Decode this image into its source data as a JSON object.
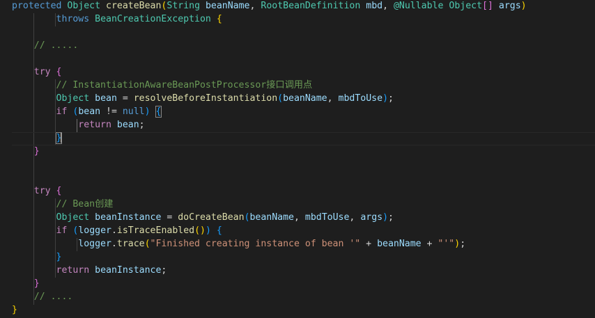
{
  "colors": {
    "background": "#1e1e1e",
    "keyword": "#569cd6",
    "control": "#c586c0",
    "type": "#4ec9b0",
    "function": "#dcdcaa",
    "variable": "#9cdcfe",
    "comment": "#6a9955",
    "string": "#ce9178",
    "bracket_1": "#ffd700",
    "bracket_2": "#da70d6",
    "bracket_3": "#179fff"
  },
  "code": {
    "lines": [
      [
        [
          "kw",
          "protected"
        ],
        [
          "pun",
          " "
        ],
        [
          "type",
          "Object"
        ],
        [
          "pun",
          " "
        ],
        [
          "fn",
          "createBean"
        ],
        [
          "b1",
          "("
        ],
        [
          "type",
          "String"
        ],
        [
          "pun",
          " "
        ],
        [
          "var",
          "beanName"
        ],
        [
          "pun",
          ", "
        ],
        [
          "type",
          "RootBeanDefinition"
        ],
        [
          "pun",
          " "
        ],
        [
          "var",
          "mbd"
        ],
        [
          "pun",
          ", "
        ],
        [
          "type",
          "@Nullable"
        ],
        [
          "pun",
          " "
        ],
        [
          "type",
          "Object"
        ],
        [
          "b2",
          "[]"
        ],
        [
          "pun",
          " "
        ],
        [
          "var",
          "args"
        ],
        [
          "b1",
          ")"
        ]
      ],
      [
        [
          "pun",
          "        "
        ],
        [
          "kw",
          "throws"
        ],
        [
          "pun",
          " "
        ],
        [
          "type",
          "BeanCreationException"
        ],
        [
          "pun",
          " "
        ],
        [
          "b1",
          "{"
        ]
      ],
      [],
      [
        [
          "pun",
          "    "
        ],
        [
          "cmt",
          "// ....."
        ]
      ],
      [],
      [
        [
          "pun",
          "    "
        ],
        [
          "ctl",
          "try"
        ],
        [
          "pun",
          " "
        ],
        [
          "b2",
          "{"
        ]
      ],
      [
        [
          "pun",
          "        "
        ],
        [
          "cmt",
          "// InstantiationAwareBeanPostProcessor接口调用点"
        ]
      ],
      [
        [
          "pun",
          "        "
        ],
        [
          "type",
          "Object"
        ],
        [
          "pun",
          " "
        ],
        [
          "var",
          "bean"
        ],
        [
          "pun",
          " = "
        ],
        [
          "fn",
          "resolveBeforeInstantiation"
        ],
        [
          "b3",
          "("
        ],
        [
          "var",
          "beanName"
        ],
        [
          "pun",
          ", "
        ],
        [
          "var",
          "mbdToUse"
        ],
        [
          "b3",
          ")"
        ],
        [
          "pun",
          ";"
        ]
      ],
      [
        [
          "pun",
          "        "
        ],
        [
          "ctl",
          "if"
        ],
        [
          "pun",
          " "
        ],
        [
          "b3",
          "("
        ],
        [
          "var",
          "bean"
        ],
        [
          "pun",
          " != "
        ],
        [
          "kw",
          "null"
        ],
        [
          "b3",
          ")"
        ],
        [
          "pun",
          " "
        ],
        [
          "b3m",
          "{"
        ]
      ],
      [
        [
          "pun",
          "            "
        ],
        [
          "ctl",
          "return"
        ],
        [
          "pun",
          " "
        ],
        [
          "var",
          "bean"
        ],
        [
          "pun",
          ";"
        ]
      ],
      [
        [
          "pun",
          "        "
        ],
        [
          "b3m",
          "}"
        ],
        [
          "cursor",
          ""
        ]
      ],
      [
        [
          "pun",
          "    "
        ],
        [
          "b2",
          "}"
        ]
      ],
      [],
      [],
      [
        [
          "pun",
          "    "
        ],
        [
          "ctl",
          "try"
        ],
        [
          "pun",
          " "
        ],
        [
          "b2",
          "{"
        ]
      ],
      [
        [
          "pun",
          "        "
        ],
        [
          "cmt",
          "// Bean创建"
        ]
      ],
      [
        [
          "pun",
          "        "
        ],
        [
          "type",
          "Object"
        ],
        [
          "pun",
          " "
        ],
        [
          "var",
          "beanInstance"
        ],
        [
          "pun",
          " = "
        ],
        [
          "fn",
          "doCreateBean"
        ],
        [
          "b3",
          "("
        ],
        [
          "var",
          "beanName"
        ],
        [
          "pun",
          ", "
        ],
        [
          "var",
          "mbdToUse"
        ],
        [
          "pun",
          ", "
        ],
        [
          "var",
          "args"
        ],
        [
          "b3",
          ")"
        ],
        [
          "pun",
          ";"
        ]
      ],
      [
        [
          "pun",
          "        "
        ],
        [
          "ctl",
          "if"
        ],
        [
          "pun",
          " "
        ],
        [
          "b3",
          "("
        ],
        [
          "var",
          "logger"
        ],
        [
          "pun",
          "."
        ],
        [
          "fn",
          "isTraceEnabled"
        ],
        [
          "b1",
          "()"
        ],
        [
          "b3",
          ")"
        ],
        [
          "pun",
          " "
        ],
        [
          "b3",
          "{"
        ]
      ],
      [
        [
          "pun",
          "            "
        ],
        [
          "var",
          "logger"
        ],
        [
          "pun",
          "."
        ],
        [
          "fn",
          "trace"
        ],
        [
          "b1",
          "("
        ],
        [
          "str",
          "\"Finished creating instance of bean '\""
        ],
        [
          "pun",
          " + "
        ],
        [
          "var",
          "beanName"
        ],
        [
          "pun",
          " + "
        ],
        [
          "str",
          "\"'\""
        ],
        [
          "b1",
          ")"
        ],
        [
          "pun",
          ";"
        ]
      ],
      [
        [
          "pun",
          "        "
        ],
        [
          "b3",
          "}"
        ]
      ],
      [
        [
          "pun",
          "        "
        ],
        [
          "ctl",
          "return"
        ],
        [
          "pun",
          " "
        ],
        [
          "var",
          "beanInstance"
        ],
        [
          "pun",
          ";"
        ]
      ],
      [
        [
          "pun",
          "    "
        ],
        [
          "b2",
          "}"
        ]
      ],
      [
        [
          "pun",
          "    "
        ],
        [
          "cmt",
          "// ...."
        ]
      ],
      [
        [
          "b1",
          "}"
        ]
      ]
    ]
  }
}
